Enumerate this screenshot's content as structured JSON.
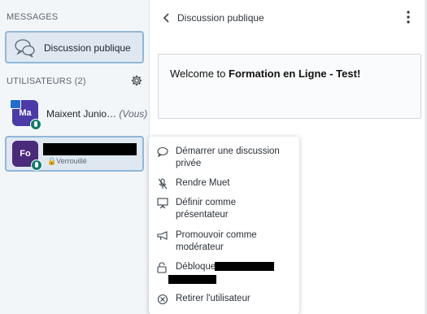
{
  "sidebar": {
    "messages_title": "MESSAGES",
    "public_chat_label": "Discussion publique",
    "users_title": "UTILISATEURS (2)",
    "users": [
      {
        "initials": "Ma",
        "name": "Maixent Junio…",
        "you_label": "(Vous)",
        "avatar_color": "#4b3aa8"
      },
      {
        "initials": "Fo",
        "status": "🔒Verrouillé",
        "avatar_color": "#4a2a7a"
      }
    ]
  },
  "chat": {
    "title": "Discussion publique",
    "welcome_prefix": "Welcome to ",
    "welcome_bold": "Formation en Ligne - Test",
    "welcome_suffix": "!"
  },
  "context_menu": {
    "items": [
      {
        "label": "Démarrer une discussion privée",
        "icon": "chat-bubble-icon"
      },
      {
        "label": "Rendre Muet",
        "icon": "mic-off-icon"
      },
      {
        "label": "Définir comme présentateur",
        "icon": "presentation-icon"
      },
      {
        "label": "Promouvoir comme modérateur",
        "icon": "megaphone-icon"
      },
      {
        "label": "Débloquer",
        "icon": "unlock-icon"
      },
      {
        "label": "Retirer l'utilisateur",
        "icon": "remove-circle-icon"
      }
    ]
  },
  "colors": {
    "accent": "#0f7b6c",
    "selection_border": "#90b7d8",
    "selection_bg": "#dfe8f1"
  }
}
